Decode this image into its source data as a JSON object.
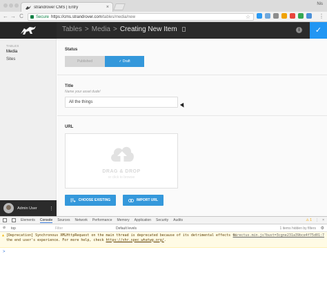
{
  "browser": {
    "tab_title": "strandrover CMS | Entry",
    "tab_close": "×",
    "profile": "Nis",
    "secure_label": "Secure",
    "url_host": "https://cms.strandrover.com",
    "url_path": "/tables/media/new",
    "nav": {
      "back": "←",
      "forward": "→",
      "reload": "C"
    },
    "star": "☆",
    "menu": "⋮",
    "extension_colors": [
      "#2b9af3",
      "#6fa8dc",
      "#8d8d8d",
      "#f0a202",
      "#e8453c",
      "#34a853",
      "#4a90d9"
    ]
  },
  "app": {
    "breadcrumb": [
      "Tables",
      "Media",
      "Creating New Item"
    ],
    "separator": ">",
    "save_icon": "✓",
    "info_icon": "i",
    "accent": "#2196f3"
  },
  "sidebar": {
    "section": "TABLES",
    "items": [
      {
        "label": "Media",
        "active": true
      },
      {
        "label": "Sites",
        "active": false
      }
    ],
    "user": "Admin User",
    "user_menu": "⋮"
  },
  "form": {
    "status": {
      "label": "Status",
      "options": [
        "Published",
        "✓ Draft"
      ],
      "selected": "Draft"
    },
    "title": {
      "label": "Title",
      "hint": "Name your asset dude!",
      "value": "All the things"
    },
    "url": {
      "label": "URL",
      "drop_title": "DRAG & DROP",
      "drop_subtitle": "or click to browse"
    },
    "buttons": {
      "choose_existing": "CHOOSE EXISTING",
      "import_url": "IMPORT URL"
    }
  },
  "devtools": {
    "tabs": [
      "Elements",
      "Console",
      "Sources",
      "Network",
      "Performance",
      "Memory",
      "Application",
      "Security",
      "Audits"
    ],
    "active_tab": "Console",
    "warning_count": "⚠ 1",
    "context": "top",
    "filter_placeholder": "Filter",
    "levels": "Default levels",
    "hidden": "1 items hidden by filters",
    "warning": {
      "text": "[Deprecation] Synchronous XMLHttpRequest on the main thread is deprecated because of its detrimental effects to the end user's experience. For more help, check",
      "link": "https://xhr.spec.whatwg.org/",
      "suffix": ".",
      "source": "directus.min.js?bust=3cgne231a39bce4f75d01:7"
    },
    "prompt": ">"
  }
}
